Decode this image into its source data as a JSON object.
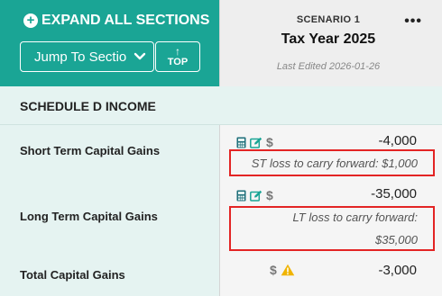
{
  "header": {
    "expand_label": "EXPAND ALL SECTIONS",
    "jump_label": "Jump To Section",
    "top_label": "TOP",
    "top_arrow": "↑"
  },
  "scenario": {
    "label": "SCENARIO 1",
    "title": "Tax Year 2025",
    "last_edited": "Last Edited 2026-01-26",
    "menu_glyph": "•••"
  },
  "section": {
    "title": "SCHEDULE D INCOME"
  },
  "rows": {
    "short_term": {
      "label": "Short Term Capital Gains",
      "value": "-4,000",
      "note": "ST loss to carry forward: $1,000",
      "icons": [
        "calculator-icon",
        "edit-icon",
        "dollar-icon"
      ]
    },
    "long_term": {
      "label": "Long Term Capital Gains",
      "value": "-35,000",
      "note_line1": "LT loss to carry forward:",
      "note_line2": "$35,000",
      "icons": [
        "calculator-icon",
        "edit-icon",
        "dollar-icon"
      ]
    },
    "total": {
      "label": "Total Capital Gains",
      "value": "-3,000",
      "icons": [
        "dollar-icon",
        "warning-icon"
      ]
    }
  },
  "colors": {
    "accent": "#1aa595",
    "highlight": "#e32424",
    "warning": "#f0b400"
  }
}
